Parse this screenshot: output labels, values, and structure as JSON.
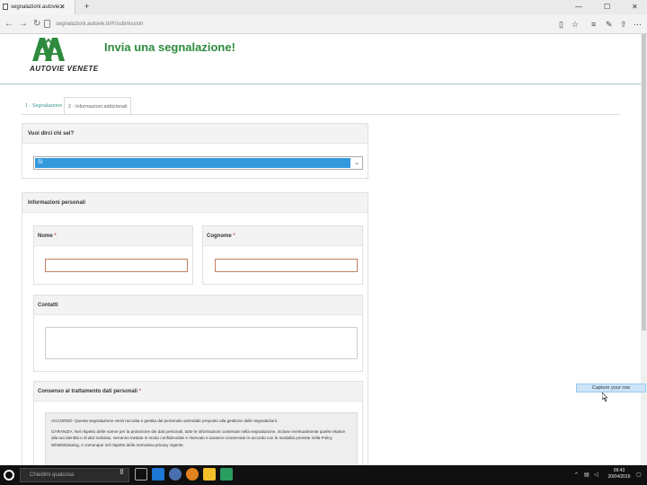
{
  "browser": {
    "tab_title": "segnalazioni.autovie...",
    "url": "segnalazioni.autovie.it/#!/submission",
    "window_controls": [
      "—",
      "☐",
      "✕"
    ]
  },
  "header": {
    "logo_text": "AUTOVIE VENETE",
    "title": "Invia una segnalazione!",
    "brand_color": "#2e8b3e"
  },
  "steps": [
    {
      "label": "1 - Segnalazione"
    },
    {
      "label": "2 - Informazioni addizionali"
    }
  ],
  "identity": {
    "question": "Vuoi dirci chi sei?",
    "selected": "Sì"
  },
  "personal": {
    "section_title": "Informazioni personali",
    "first_name_label": "Nome",
    "last_name_label": "Cognome",
    "required_mark": "*",
    "contacts_label": "Contatti"
  },
  "consent": {
    "title": "Consenso al trattamento dati personali",
    "para1": "ACCORDO: Questa segnalazione verrà raccolta e gestita dal personale aziendale preposto alla gestione delle segnalazioni.",
    "para2": "GARANZIA: Nel rispetto delle norme per la protezione dei dati personali, tutte le informazioni contenute nella segnalazione, incluse eventualmente quelle relative alla tua identità o di altri individui, verranno trattate in modo confidenziale e riservato e saranno conservate in accordo con le modalità previste nella Policy Whistleblowing, e comunque nel rispetto della normativa privacy vigente."
  },
  "capture_tooltip": "Capture your row",
  "taskbar": {
    "search_placeholder": "Chiedimi qualcosa",
    "time": "09:43",
    "date": "20/04/2016"
  }
}
